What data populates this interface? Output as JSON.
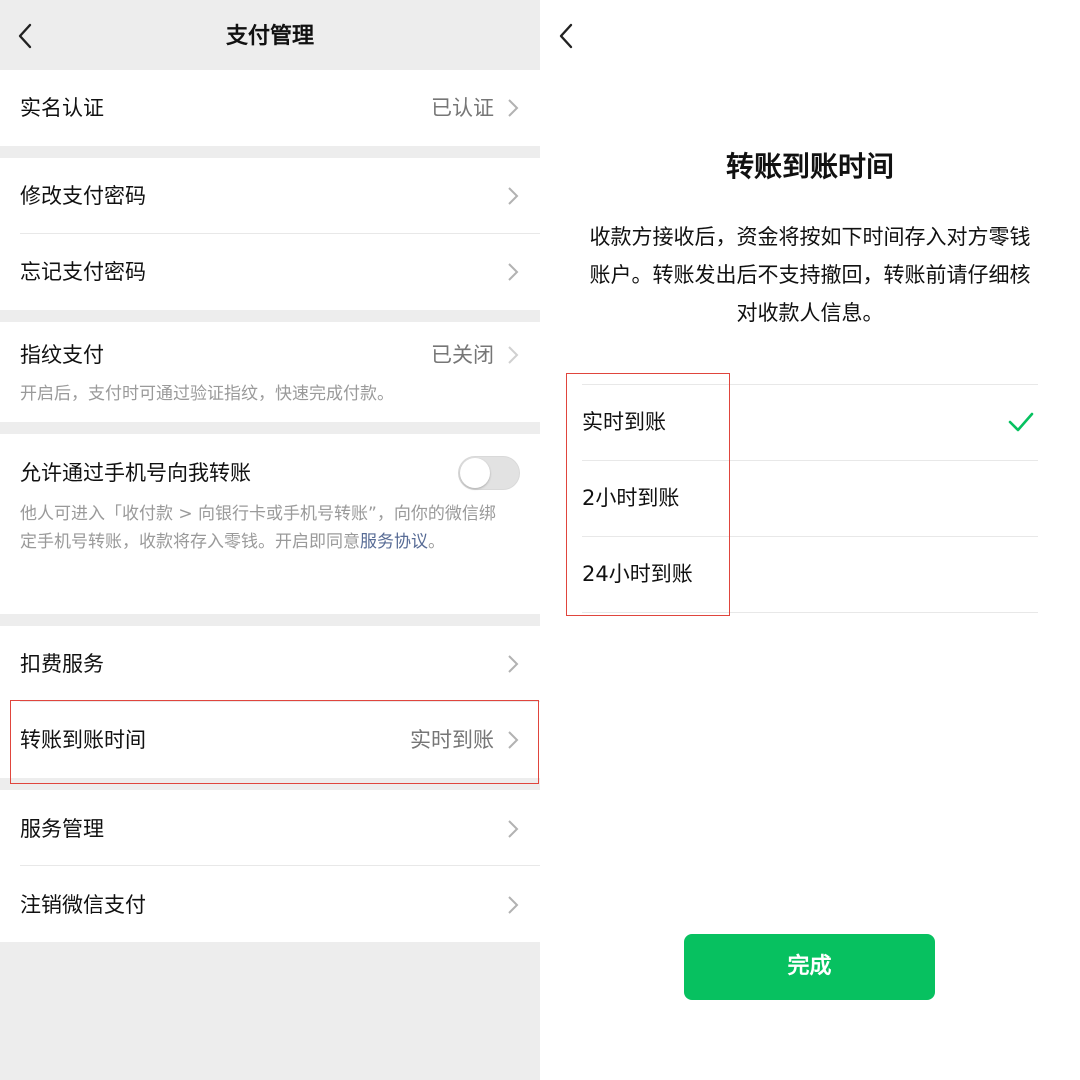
{
  "left": {
    "title": "支付管理",
    "rows": {
      "real_name": {
        "label": "实名认证",
        "value": "已认证"
      },
      "change_pwd": {
        "label": "修改支付密码"
      },
      "forgot_pwd": {
        "label": "忘记支付密码"
      },
      "fingerprint": {
        "label": "指纹支付",
        "value": "已关闭",
        "desc": "开启后，支付时可通过验证指纹，快速完成付款。"
      },
      "phone_transfer": {
        "label": "允许通过手机号向我转账",
        "toggle_on": false,
        "desc": "他人可进入「收付款 > 向银行卡或手机号转账”，向你的微信绑定手机号转账，收款将存入零钱。开启即同意",
        "link": "服务协议",
        "desc_end": "。"
      },
      "deduction": {
        "label": "扣费服务"
      },
      "transfer_time": {
        "label": "转账到账时间",
        "value": "实时到账"
      },
      "service_mgmt": {
        "label": "服务管理"
      },
      "close_pay": {
        "label": "注销微信支付"
      }
    }
  },
  "right": {
    "title": "转账到账时间",
    "description": "收款方接收后，资金将按如下时间存入对方零钱账户。转账发出后不支持撤回，转账前请仔细核对收款人信息。",
    "options": [
      {
        "label": "实时到账",
        "selected": true
      },
      {
        "label": "2小时到账",
        "selected": false
      },
      {
        "label": "24小时到账",
        "selected": false
      }
    ],
    "done_button": "完成"
  },
  "colors": {
    "accent_green": "#07c160",
    "link_blue": "#576b95",
    "highlight_red": "#e0453d",
    "background_gray": "#ededed"
  },
  "icons": [
    "back-chevron-icon",
    "chevron-right-icon",
    "checkmark-icon"
  ]
}
